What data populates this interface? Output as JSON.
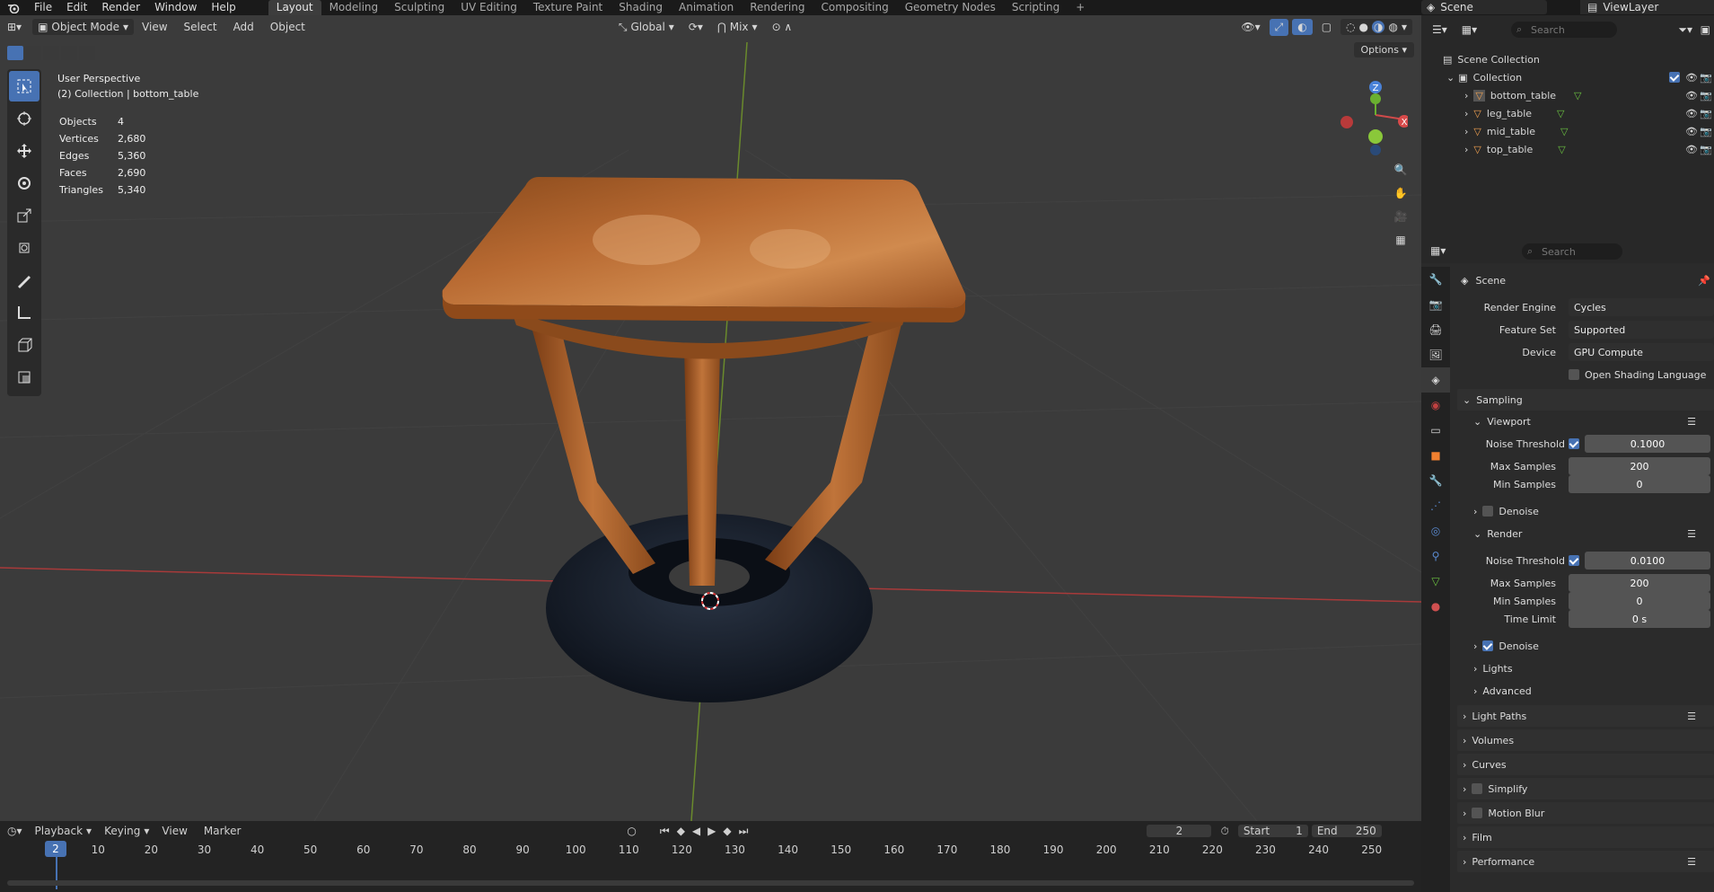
{
  "menu": {
    "items": [
      "File",
      "Edit",
      "Render",
      "Window",
      "Help"
    ]
  },
  "workspaces": {
    "tabs": [
      "Layout",
      "Modeling",
      "Sculpting",
      "UV Editing",
      "Texture Paint",
      "Shading",
      "Animation",
      "Rendering",
      "Compositing",
      "Geometry Nodes",
      "Scripting"
    ],
    "active": "Layout"
  },
  "topright": {
    "scene": "Scene",
    "view_layer": "ViewLayer"
  },
  "viewport": {
    "mode": "Object Mode",
    "menus": [
      "View",
      "Select",
      "Add",
      "Object"
    ],
    "orientation": "Global",
    "snap_mode": "Mix",
    "options": "Options",
    "perspective": "User Perspective",
    "context": "(2) Collection | bottom_table",
    "stats": [
      {
        "label": "Objects",
        "value": "4"
      },
      {
        "label": "Vertices",
        "value": "2,680"
      },
      {
        "label": "Edges",
        "value": "5,360"
      },
      {
        "label": "Faces",
        "value": "2,690"
      },
      {
        "label": "Triangles",
        "value": "5,340"
      }
    ],
    "gizmo": {
      "z": "Z",
      "x": "X"
    }
  },
  "timeline": {
    "menus": [
      "Playback",
      "Keying",
      "View",
      "Marker"
    ],
    "current_frame": "2",
    "start_label": "Start",
    "start": "1",
    "end_label": "End",
    "end": "250",
    "ticks": [
      "10",
      "20",
      "30",
      "40",
      "50",
      "60",
      "70",
      "80",
      "90",
      "100",
      "110",
      "120",
      "130",
      "140",
      "150",
      "160",
      "170",
      "180",
      "190",
      "200",
      "210",
      "220",
      "230",
      "240",
      "250"
    ]
  },
  "outliner": {
    "search_placeholder": "Search",
    "scene_collection": "Scene Collection",
    "collection": "Collection",
    "objects": [
      "bottom_table",
      "leg_table",
      "mid_table",
      "top_table"
    ]
  },
  "properties": {
    "search_placeholder": "Search",
    "context": "Scene",
    "render_engine_label": "Render Engine",
    "render_engine": "Cycles",
    "feature_set_label": "Feature Set",
    "feature_set": "Supported",
    "device_label": "Device",
    "device": "GPU Compute",
    "osl": "Open Shading Language",
    "sampling": "Sampling",
    "viewport": "Viewport",
    "noise_threshold_label": "Noise Threshold",
    "vp_noise_threshold": "0.1000",
    "max_samples_label": "Max Samples",
    "vp_max_samples": "200",
    "min_samples_label": "Min Samples",
    "vp_min_samples": "0",
    "denoise": "Denoise",
    "render": "Render",
    "r_noise_threshold": "0.0100",
    "r_max_samples": "200",
    "r_min_samples": "0",
    "time_limit_label": "Time Limit",
    "time_limit": "0 s",
    "lights": "Lights",
    "advanced": "Advanced",
    "light_paths": "Light Paths",
    "volumes": "Volumes",
    "curves": "Curves",
    "simplify": "Simplify",
    "motion_blur": "Motion Blur",
    "film": "Film",
    "performance": "Performance"
  }
}
